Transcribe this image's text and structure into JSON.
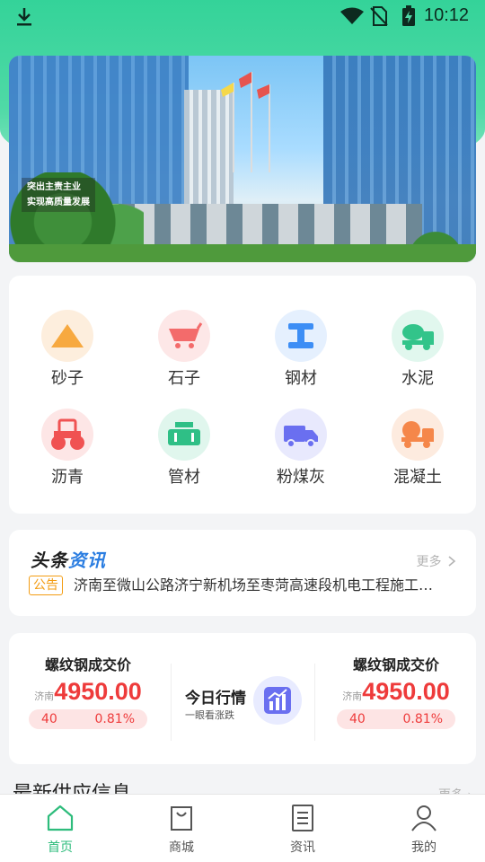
{
  "status_bar": {
    "time": "10:12",
    "icons": [
      "download-icon",
      "wifi-icon",
      "no-sim-icon",
      "battery-charging-icon"
    ]
  },
  "banner": {
    "slogan_line1": "突出主责主业",
    "slogan_line2": "实现高质量发展"
  },
  "categories": [
    {
      "label": "砂子",
      "icon": "sand-icon",
      "color": "#f7a940"
    },
    {
      "label": "石子",
      "icon": "cart-icon",
      "color": "#f36b6b"
    },
    {
      "label": "钢材",
      "icon": "steel-icon",
      "color": "#3d8ef5"
    },
    {
      "label": "水泥",
      "icon": "cement-mixer-icon",
      "color": "#32c48a"
    },
    {
      "label": "沥青",
      "icon": "road-roller-icon",
      "color": "#f05252"
    },
    {
      "label": "管材",
      "icon": "pipe-icon",
      "color": "#2fbf86"
    },
    {
      "label": "粉煤灰",
      "icon": "truck-icon",
      "color": "#6a6ff0"
    },
    {
      "label": "混凝土",
      "icon": "concrete-truck-icon",
      "color": "#f5874a"
    }
  ],
  "news": {
    "title_part1": "头条",
    "title_part2": "资讯",
    "more": "更多",
    "tag": "公告",
    "headline": "济南至微山公路济宁新机场至枣菏高速段机电工程施工…"
  },
  "market": {
    "left": {
      "title": "螺纹钢成交价",
      "city": "济南",
      "price": "4950.00",
      "change": "40",
      "percent": "0.81%"
    },
    "center": {
      "title": "今日行情",
      "subtitle": "一眼看涨跌"
    },
    "right": {
      "title": "螺纹钢成交价",
      "city": "济南",
      "price": "4950.00",
      "change": "40",
      "percent": "0.81%"
    }
  },
  "supply": {
    "title": "最新供应信息",
    "more": "更多"
  },
  "tabbar": [
    {
      "label": "首页",
      "icon": "home-icon",
      "active": true
    },
    {
      "label": "商城",
      "icon": "shopping-bag-icon",
      "active": false
    },
    {
      "label": "资讯",
      "icon": "document-icon",
      "active": false
    },
    {
      "label": "我的",
      "icon": "user-icon",
      "active": false
    }
  ],
  "colors": {
    "primary": "#2ebc7c",
    "price_red": "#ee3b3b",
    "news_blue": "#2a7de1",
    "tag_orange": "#f39c12"
  }
}
